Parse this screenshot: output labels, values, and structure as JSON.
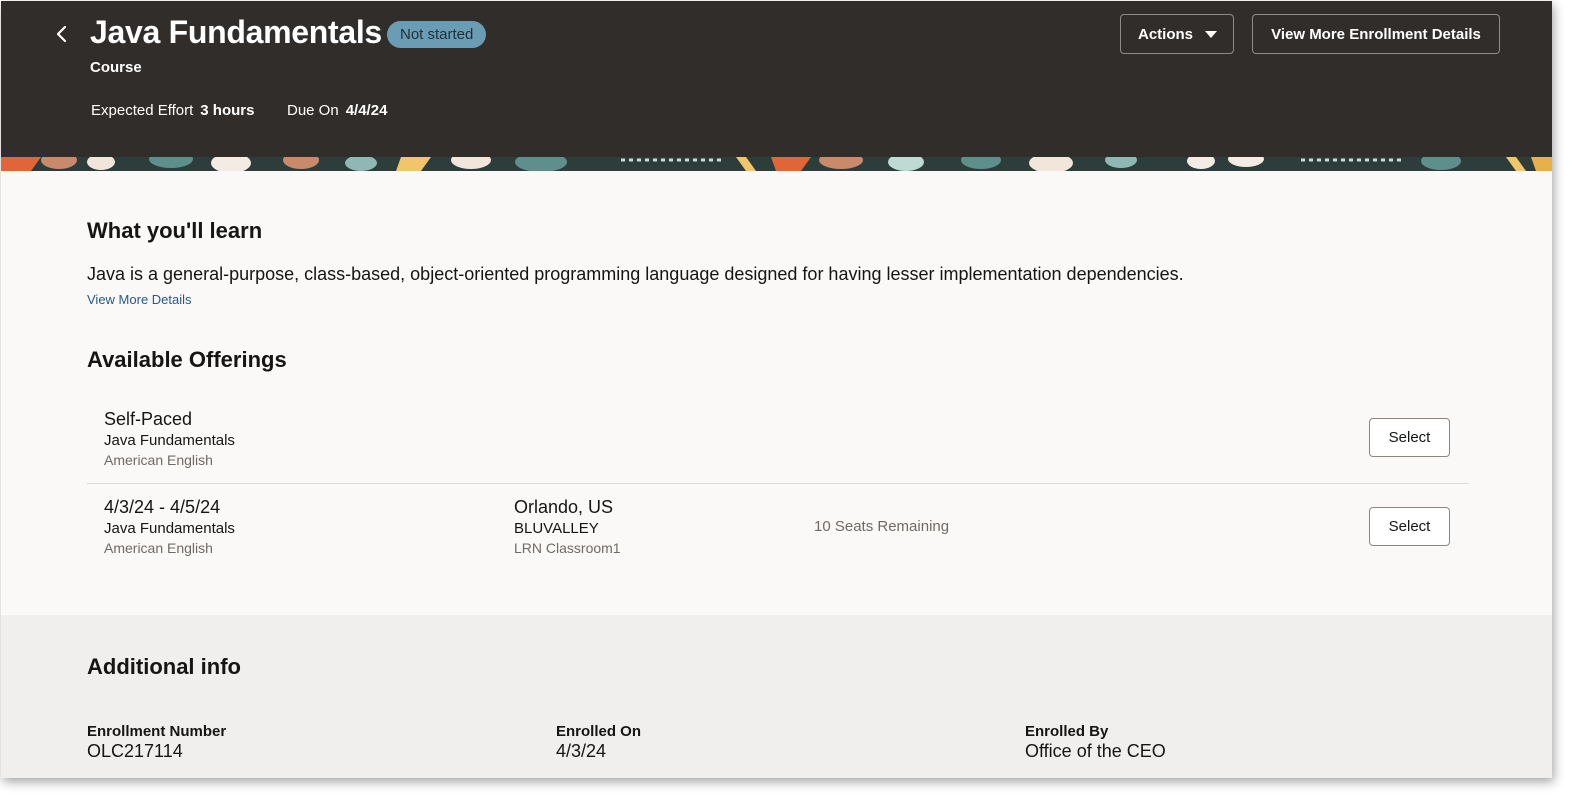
{
  "header": {
    "title": "Java Fundamentals",
    "status_badge": "Not started",
    "type": "Course",
    "effort_label": "Expected Effort",
    "effort_value": "3 hours",
    "due_label": "Due On",
    "due_value": "4/4/24",
    "actions_label": "Actions",
    "view_more_enrollment_label": "View More Enrollment Details"
  },
  "learn": {
    "heading": "What you'll learn",
    "description": "Java is a general-purpose, class-based, object-oriented programming language designed for having lesser implementation dependencies.",
    "view_more_link": "View More Details"
  },
  "offerings": {
    "heading": "Available Offerings",
    "items": [
      {
        "title": "Self-Paced",
        "course": "Java Fundamentals",
        "language": "American English",
        "location": "",
        "facility": "",
        "room": "",
        "seats": "",
        "select_label": "Select"
      },
      {
        "title": "4/3/24 - 4/5/24",
        "course": "Java Fundamentals",
        "language": "American English",
        "location": "Orlando, US",
        "facility": "BLUVALLEY",
        "room": "LRN Classroom1",
        "seats": "10 Seats Remaining",
        "select_label": "Select"
      }
    ]
  },
  "additional": {
    "heading": "Additional info",
    "fields": [
      {
        "label": "Enrollment Number",
        "value": "OLC217114"
      },
      {
        "label": "Enrolled On",
        "value": "4/3/24"
      },
      {
        "label": "Enrolled By",
        "value": "Office of the CEO"
      }
    ]
  },
  "colors": {
    "header_bg": "#312d2a",
    "badge_bg": "#6a9cb3",
    "link": "#26588a",
    "page_bg": "#faf9f8",
    "additional_bg": "#f1efed"
  },
  "icons": {
    "back": "chevron-left-icon",
    "actions_caret": "caret-down-icon"
  }
}
